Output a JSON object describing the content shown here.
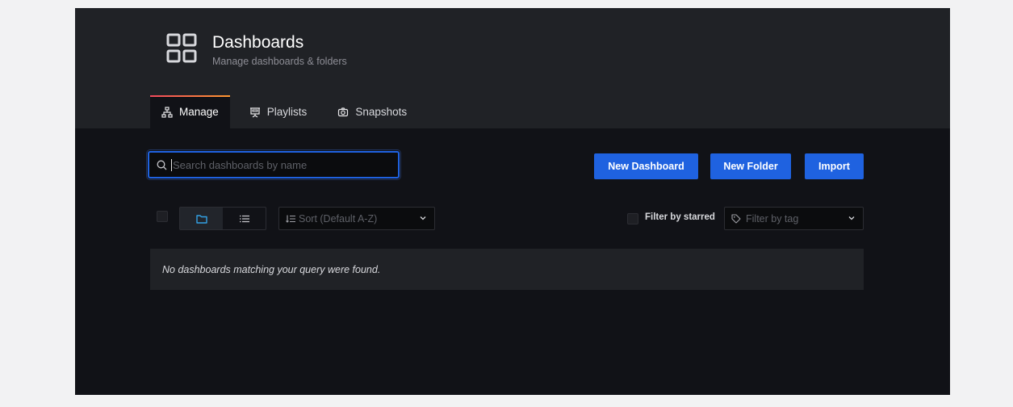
{
  "header": {
    "icon": "apps-grid-icon",
    "title": "Dashboards",
    "subtitle": "Manage dashboards & folders"
  },
  "tabs": [
    {
      "label": "Manage",
      "icon": "sitemap-icon",
      "active": true
    },
    {
      "label": "Playlists",
      "icon": "presentation-icon",
      "active": false
    },
    {
      "label": "Snapshots",
      "icon": "camera-icon",
      "active": false
    }
  ],
  "search": {
    "placeholder": "Search dashboards by name",
    "value": ""
  },
  "actions": {
    "new_dashboard": "New Dashboard",
    "new_folder": "New Folder",
    "import": "Import"
  },
  "toolbar": {
    "view_modes": [
      {
        "name": "folder-view",
        "icon": "folder-icon",
        "active": true
      },
      {
        "name": "list-view",
        "icon": "list-icon",
        "active": false
      }
    ],
    "sort_placeholder": "Sort (Default A-Z)",
    "filter_starred_label": "Filter by starred",
    "filter_tag_placeholder": "Filter by tag"
  },
  "results": {
    "empty_message": "No dashboards matching your query were found."
  },
  "colors": {
    "primary": "#1f62e0",
    "background": "#111217",
    "panel": "#202226",
    "tab_accent_start": "#f2495c",
    "tab_accent_end": "#ff9830"
  }
}
